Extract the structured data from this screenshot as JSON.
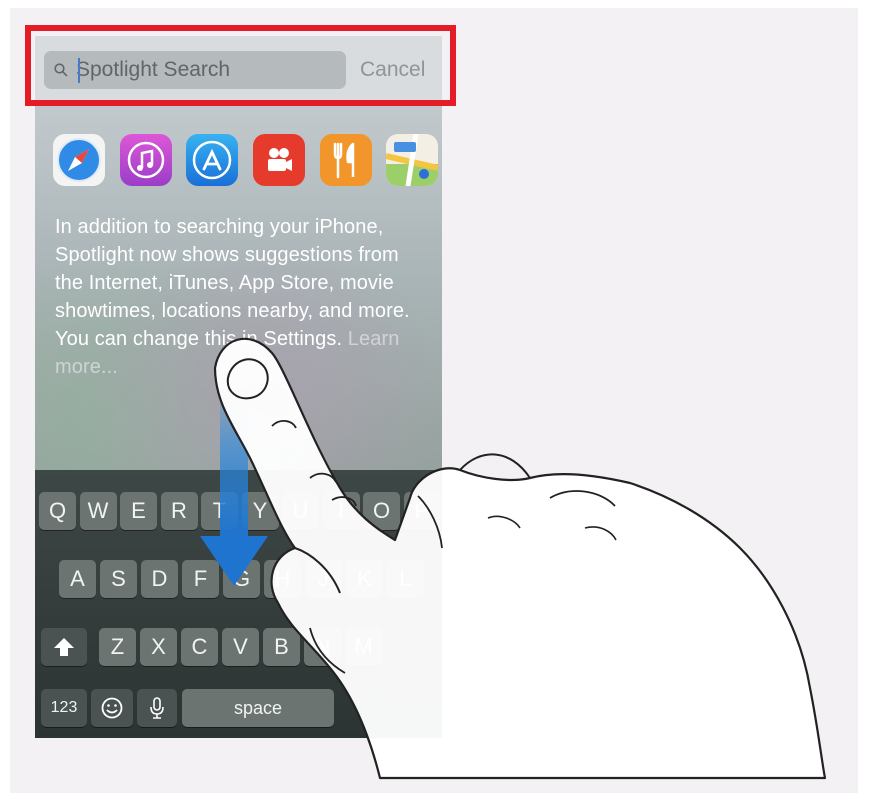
{
  "search": {
    "placeholder": "Spotlight Search",
    "cancel_label": "Cancel"
  },
  "apps": [
    {
      "name": "safari-icon",
      "color": "#2f8be6"
    },
    {
      "name": "itunes-icon",
      "color": "#c44ec9"
    },
    {
      "name": "app-store-icon",
      "color": "#1f8ce6"
    },
    {
      "name": "movies-icon",
      "color": "#e53a2c"
    },
    {
      "name": "restaurants-icon",
      "color": "#f2952a"
    },
    {
      "name": "maps-icon",
      "color": "#7fc25a"
    }
  ],
  "info": {
    "text": "In addition to searching your iPhone, Spotlight now shows suggestions from the Internet, iTunes, App Store, movie showtimes, locations nearby, and more. You can change this in Settings.",
    "learn_more": "Learn more..."
  },
  "keyboard": {
    "row1": [
      "Q",
      "W",
      "E",
      "R",
      "T",
      "Y",
      "U",
      "I",
      "O",
      "P"
    ],
    "row2": [
      "A",
      "S",
      "D",
      "F",
      "G",
      "H",
      "J",
      "K",
      "L"
    ],
    "row3": [
      "Z",
      "X",
      "C",
      "V",
      "B",
      "N",
      "M"
    ],
    "shift_icon": "shift-arrow-icon",
    "numbers_label": "123",
    "emoji_icon": "emoji-icon",
    "mic_icon": "microphone-icon",
    "space_label": "space"
  },
  "colors": {
    "highlight": "#e41c26",
    "arrow": "#1f7fd6"
  }
}
